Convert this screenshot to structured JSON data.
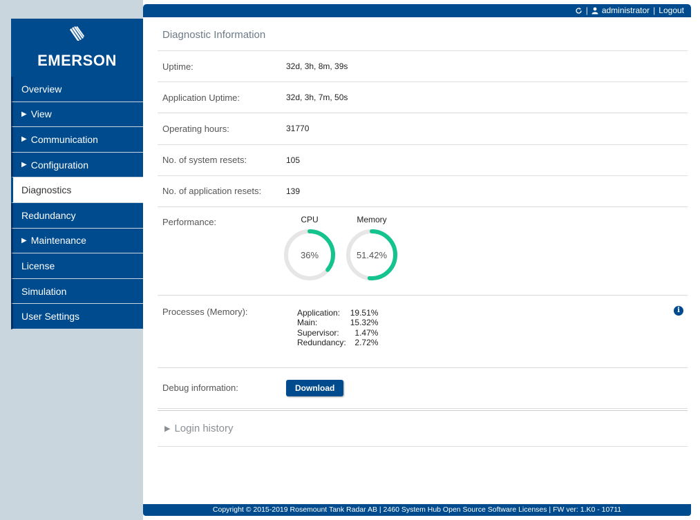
{
  "header": {
    "user": "administrator",
    "logout_label": "Logout"
  },
  "logo": {
    "brand": "EMERSON"
  },
  "sidebar": {
    "items": [
      {
        "label": "Overview",
        "expandable": false,
        "active": false
      },
      {
        "label": "View",
        "expandable": true,
        "active": false
      },
      {
        "label": "Communication",
        "expandable": true,
        "active": false
      },
      {
        "label": "Configuration",
        "expandable": true,
        "active": false
      },
      {
        "label": "Diagnostics",
        "expandable": false,
        "active": true
      },
      {
        "label": "Redundancy",
        "expandable": false,
        "active": false
      },
      {
        "label": "Maintenance",
        "expandable": true,
        "active": false
      },
      {
        "label": "License",
        "expandable": false,
        "active": false
      },
      {
        "label": "Simulation",
        "expandable": false,
        "active": false
      },
      {
        "label": "User Settings",
        "expandable": false,
        "active": false
      }
    ]
  },
  "main": {
    "title": "Diagnostic Information",
    "rows": [
      {
        "label": "Uptime:",
        "value": "32d, 3h, 8m, 39s"
      },
      {
        "label": "Application Uptime:",
        "value": "32d, 3h, 7m, 50s"
      },
      {
        "label": "Operating hours:",
        "value": "31770"
      },
      {
        "label": "No. of system resets:",
        "value": "105"
      },
      {
        "label": "No. of application resets:",
        "value": "139"
      }
    ],
    "performance": {
      "label": "Performance:",
      "cpu": {
        "title": "CPU",
        "value_text": "36%",
        "fraction": 0.36
      },
      "memory": {
        "title": "Memory",
        "value_text": "51.42%",
        "fraction": 0.5142
      }
    },
    "processes": {
      "label": "Processes (Memory):",
      "items": [
        {
          "name": "Application:",
          "value": "19.51%"
        },
        {
          "name": "Main:",
          "value": "15.32%"
        },
        {
          "name": "Supervisor:",
          "value": "1.47%"
        },
        {
          "name": "Redundancy:",
          "value": "2.72%"
        }
      ]
    },
    "debug": {
      "label": "Debug information:",
      "button_label": "Download"
    },
    "login_history_label": "Login history"
  },
  "footer": {
    "text": "Copyright © 2015-2019 Rosemount Tank Radar AB  |  2460 System Hub Open Source Software Licenses  |  FW ver: 1.K0 - 10711"
  },
  "colors": {
    "brand_blue": "#004b8d",
    "gauge_green": "#14c38e",
    "gauge_track": "#e6e6e6"
  }
}
